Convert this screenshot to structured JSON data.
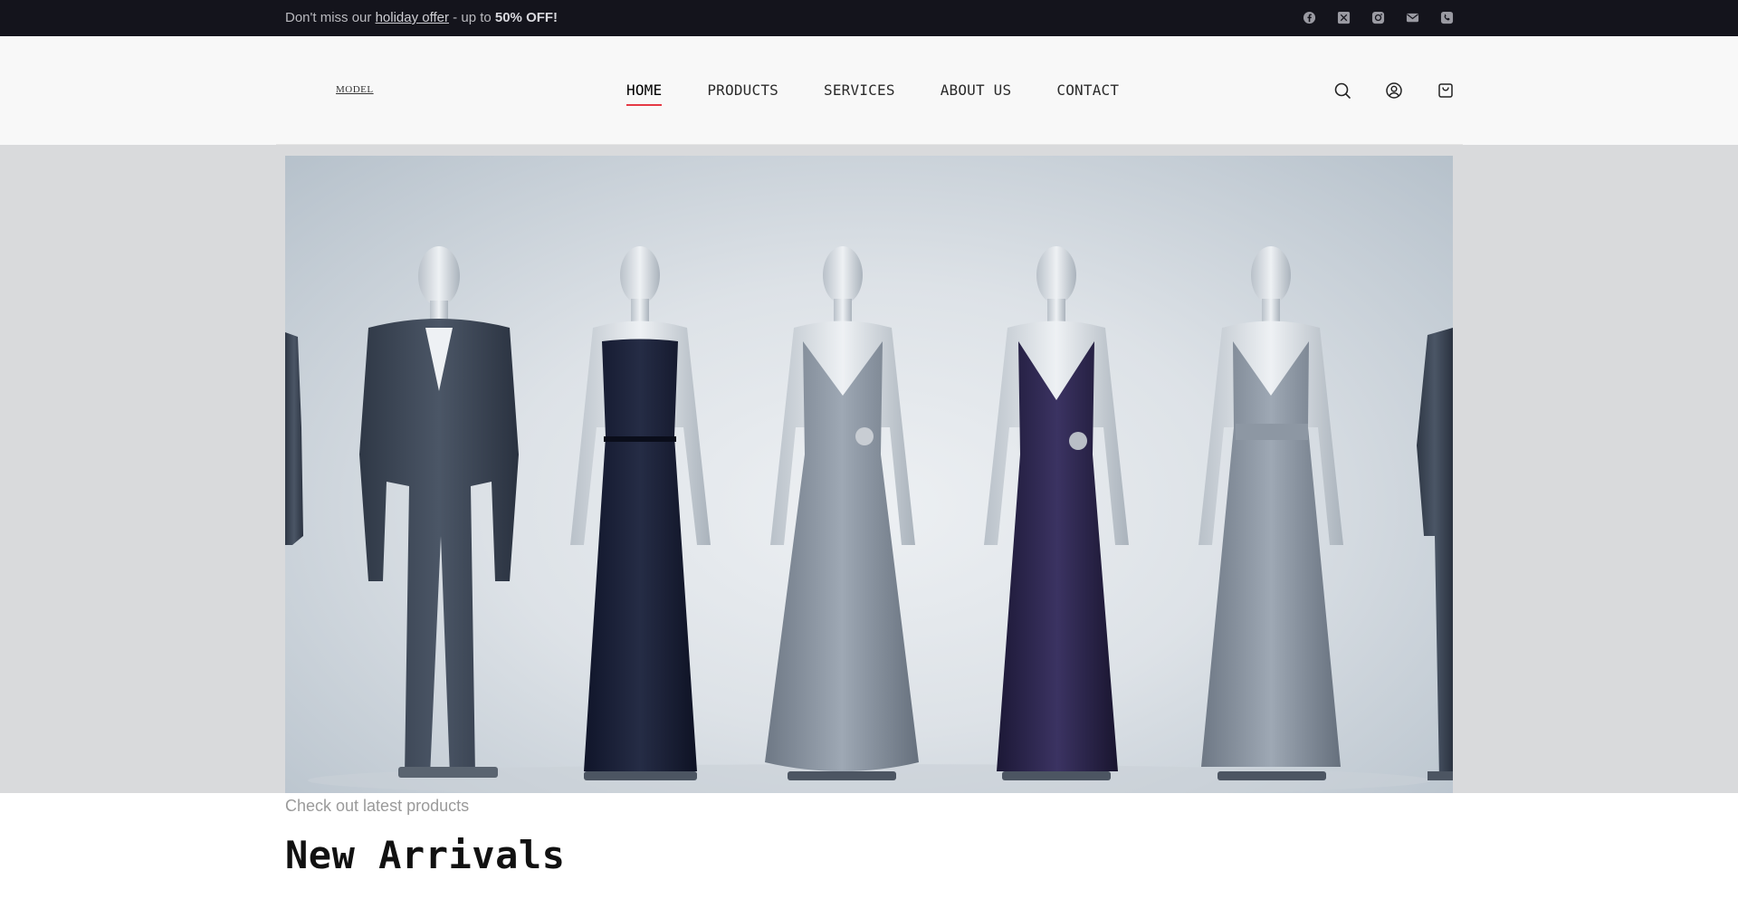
{
  "announcement": {
    "prefix": "Don't miss our ",
    "link_text": "holiday offer",
    "middle": " - up to ",
    "highlight": "50% OFF!"
  },
  "social_icons": [
    "facebook-icon",
    "x-twitter-icon",
    "instagram-icon",
    "email-icon",
    "phone-icon"
  ],
  "header": {
    "logo": "MODEL",
    "nav": [
      {
        "label": "HOME",
        "active": true
      },
      {
        "label": "PRODUCTS",
        "active": false
      },
      {
        "label": "SERVICES",
        "active": false
      },
      {
        "label": "ABOUT US",
        "active": false
      },
      {
        "label": "CONTACT",
        "active": false
      }
    ],
    "icons": [
      "search-icon",
      "account-icon",
      "cart-icon"
    ]
  },
  "hero": {
    "figures": [
      "suit",
      "navy-gown",
      "silver-drape-gown",
      "purple-gown",
      "silver-pleated-gown"
    ]
  },
  "section": {
    "kicker": "Check out latest products",
    "title": "New Arrivals"
  },
  "colors": {
    "topbar_bg": "#14141c",
    "header_bg": "#f8f8f8",
    "accent": "#e53945",
    "hero_band": "#d9dadc"
  }
}
